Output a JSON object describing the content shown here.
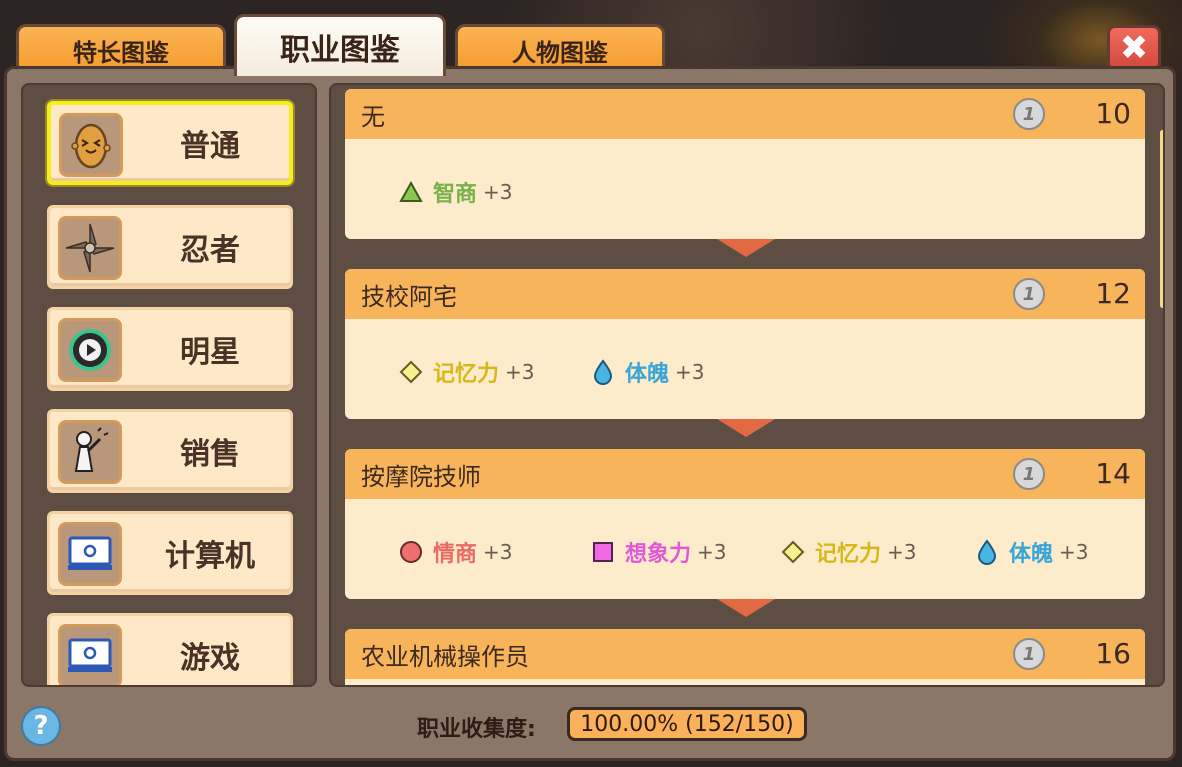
{
  "tabs": [
    {
      "label": "特长图鉴",
      "active": false
    },
    {
      "label": "职业图鉴",
      "active": true
    },
    {
      "label": "人物图鉴",
      "active": false
    }
  ],
  "close_icon": "close-icon",
  "categories": [
    {
      "label": "普通",
      "icon": "potato-icon",
      "selected": true
    },
    {
      "label": "忍者",
      "icon": "shuriken-icon",
      "selected": false
    },
    {
      "label": "明星",
      "icon": "play-icon",
      "selected": false
    },
    {
      "label": "销售",
      "icon": "salesman-icon",
      "selected": false
    },
    {
      "label": "计算机",
      "icon": "computer-icon",
      "selected": false
    },
    {
      "label": "游戏",
      "icon": "computer-icon",
      "selected": false
    }
  ],
  "jobs": [
    {
      "name": "无",
      "level": "10",
      "coin": "1",
      "stats": [
        {
          "name": "智商",
          "bonus": "+3",
          "symbol": "triangle",
          "color": "#7ab04a"
        }
      ]
    },
    {
      "name": "技校阿宅",
      "level": "12",
      "coin": "1",
      "stats": [
        {
          "name": "记忆力",
          "bonus": "+3",
          "symbol": "diamond",
          "color": "#d6b818"
        },
        {
          "name": "体魄",
          "bonus": "+3",
          "symbol": "drop",
          "color": "#3aa6d6"
        }
      ]
    },
    {
      "name": "按摩院技师",
      "level": "14",
      "coin": "1",
      "stats": [
        {
          "name": "情商",
          "bonus": "+3",
          "symbol": "circle",
          "color": "#ea6a66"
        },
        {
          "name": "想象力",
          "bonus": "+3",
          "symbol": "square",
          "color": "#e05ad6"
        },
        {
          "name": "记忆力",
          "bonus": "+3",
          "symbol": "diamond",
          "color": "#d6b818"
        },
        {
          "name": "体魄",
          "bonus": "+3",
          "symbol": "drop",
          "color": "#3aa6d6"
        }
      ]
    },
    {
      "name": "农业机械操作员",
      "level": "16",
      "coin": "1",
      "stats": []
    }
  ],
  "footer": {
    "label": "职业收集度:",
    "progress_text": "100.00%  (152/150)"
  },
  "help_label": "?"
}
